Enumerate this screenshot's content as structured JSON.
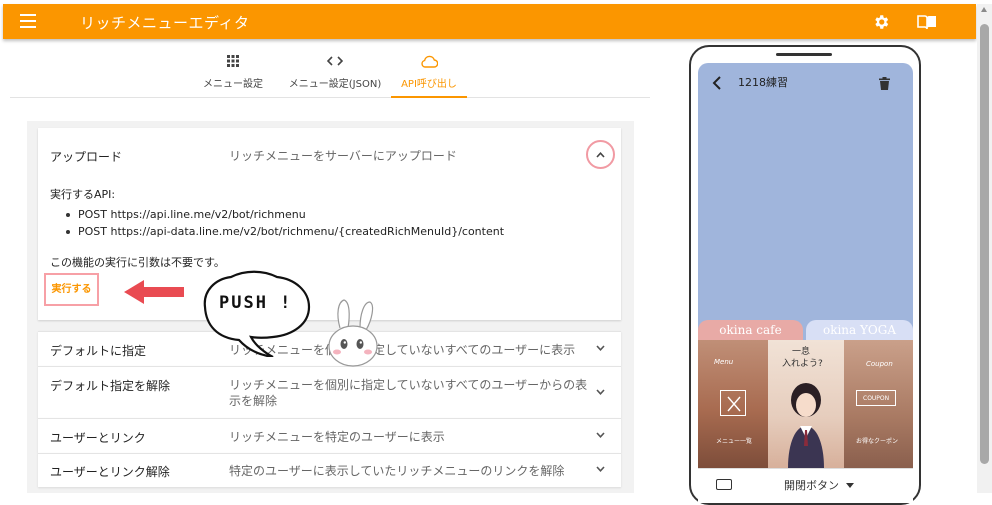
{
  "app": {
    "title": "リッチメニューエディタ",
    "accent_color": "#fb9600",
    "icons": [
      "menu-icon",
      "gear-icon",
      "book-icon"
    ]
  },
  "tabs": [
    {
      "label": "メニュー設定",
      "icon": "grid-icon",
      "active": false
    },
    {
      "label": "メニュー設定(JSON)",
      "icon": "code-icon",
      "active": false
    },
    {
      "label": "API呼び出し",
      "icon": "cloud-icon",
      "active": true
    }
  ],
  "sections": {
    "upload": {
      "label": "アップロード",
      "description": "リッチメニューをサーバーにアップロード",
      "api_title": "実行するAPI:",
      "apis": [
        "POST https://api.line.me/v2/bot/richmenu",
        "POST https://api-data.line.me/v2/bot/richmenu/{createdRichMenuId}/content"
      ],
      "note": "この機能の実行に引数は不要です。",
      "execute_label": "実行する"
    },
    "rows": [
      {
        "label": "デフォルトに指定",
        "description": "リッチメニューを個別に指定していないすべてのユーザーに表示"
      },
      {
        "label": "デフォルト指定を解除",
        "description": "リッチメニューを個別に指定していないすべてのユーザーからの表示を解除"
      },
      {
        "label": "ユーザーとリンク",
        "description": "リッチメニューを特定のユーザーに表示"
      },
      {
        "label": "ユーザーとリンク解除",
        "description": "特定のユーザーに表示していたリッチメニューのリンクを解除"
      }
    ]
  },
  "annotation": {
    "bubble_text": "PUSH !"
  },
  "preview": {
    "chat_title": "1218練習",
    "richmenu_tabs": [
      "okina cafe",
      "okina YOGA"
    ],
    "richmenu_image_text": {
      "left_caption": "Menu",
      "left_bottom": "メニュー一覧",
      "center_line1": "一息",
      "center_line2": "入れよう?",
      "right_caption": "Coupon",
      "right_box": "COUPON",
      "right_bottom": "お得なクーポン"
    },
    "toggle_label": "開閉ボタン"
  }
}
